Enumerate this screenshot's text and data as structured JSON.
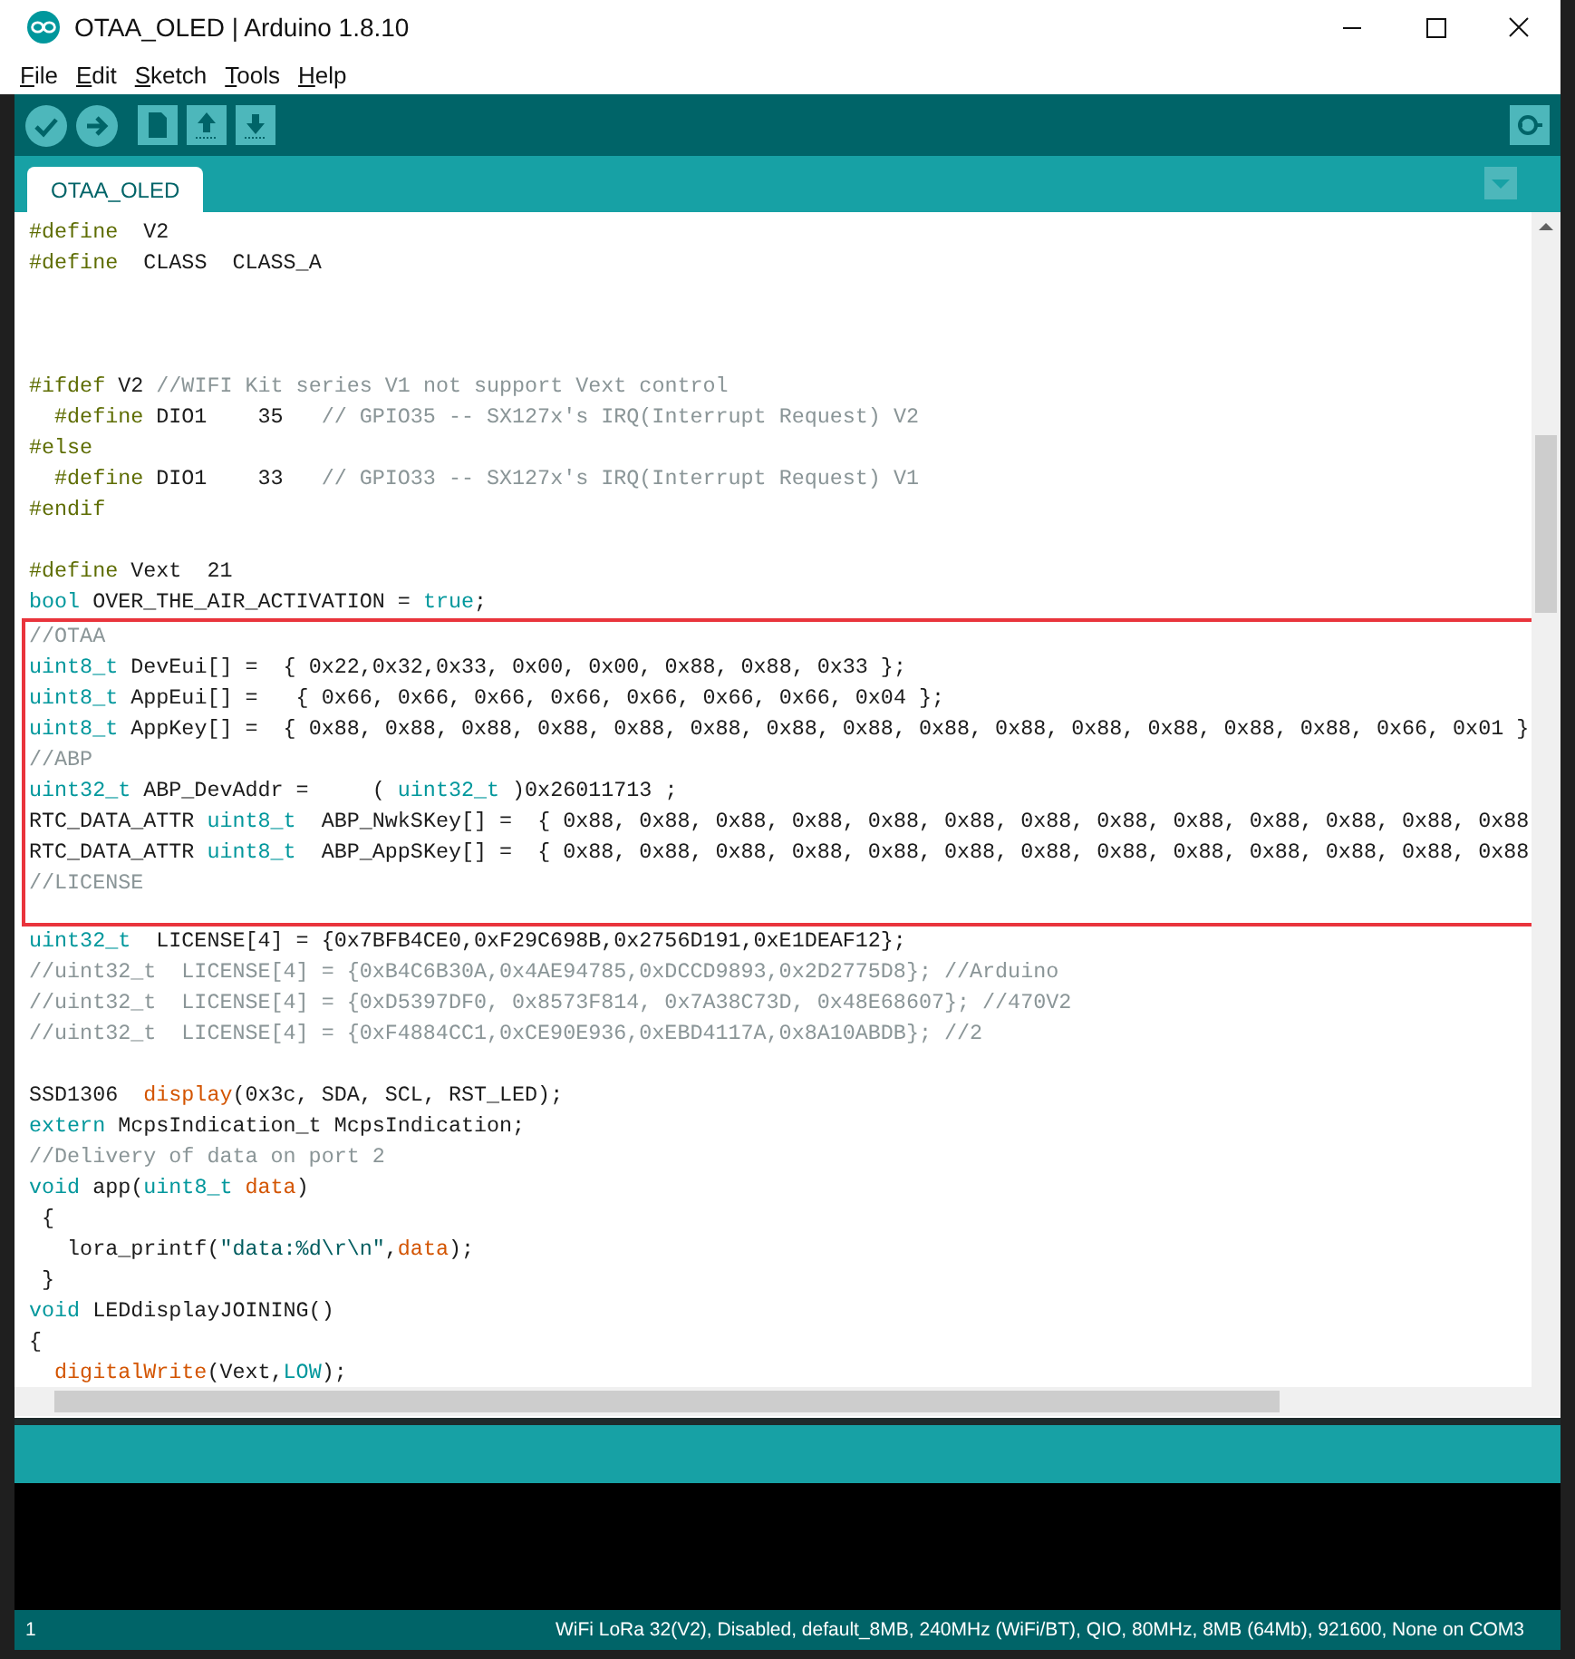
{
  "window": {
    "title": "OTAA_OLED | Arduino 1.8.10"
  },
  "menu": [
    "File",
    "Edit",
    "Sketch",
    "Tools",
    "Help"
  ],
  "tabs": [
    {
      "label": "OTAA_OLED",
      "selected": true
    }
  ],
  "code": [
    {
      "kind": "plain",
      "lines": [
        {
          "kind": "code",
          "tokens": [
            {
              "t": "#define",
              "kind": "directive"
            },
            {
              "t": "  V2",
              "kind": "plain"
            }
          ]
        },
        {
          "kind": "code",
          "tokens": [
            {
              "t": "#define",
              "kind": "directive"
            },
            {
              "t": "  CLASS  CLASS_A",
              "kind": "plain"
            }
          ]
        },
        {
          "kind": "blank"
        },
        {
          "kind": "blank"
        },
        {
          "kind": "blank"
        },
        {
          "kind": "code",
          "tokens": [
            {
              "t": "#ifdef",
              "kind": "directive"
            },
            {
              "t": " V2 ",
              "kind": "plain"
            },
            {
              "t": "//WIFI Kit series V1 not support Vext control",
              "kind": "comment"
            }
          ]
        },
        {
          "kind": "code",
          "tokens": [
            {
              "t": "  #define",
              "kind": "directive"
            },
            {
              "t": " DIO1    35   ",
              "kind": "plain"
            },
            {
              "t": "// GPIO35 -- SX127x's IRQ(Interrupt Request) V2",
              "kind": "comment"
            }
          ]
        },
        {
          "kind": "code",
          "tokens": [
            {
              "t": "#else",
              "kind": "directive"
            }
          ]
        },
        {
          "kind": "code",
          "tokens": [
            {
              "t": "  #define",
              "kind": "directive"
            },
            {
              "t": " DIO1    33   ",
              "kind": "plain"
            },
            {
              "t": "// GPIO33 -- SX127x's IRQ(Interrupt Request) V1",
              "kind": "comment"
            }
          ]
        },
        {
          "kind": "code",
          "tokens": [
            {
              "t": "#endif",
              "kind": "directive"
            }
          ]
        },
        {
          "kind": "blank"
        },
        {
          "kind": "code",
          "tokens": [
            {
              "t": "#define",
              "kind": "directive"
            },
            {
              "t": " Vext  21",
              "kind": "plain"
            }
          ]
        },
        {
          "kind": "code",
          "tokens": [
            {
              "t": "bool",
              "kind": "keyword"
            },
            {
              "t": " OVER_THE_AIR_ACTIVATION = ",
              "kind": "plain"
            },
            {
              "t": "true",
              "kind": "keyword"
            },
            {
              "t": ";",
              "kind": "plain"
            }
          ]
        }
      ]
    },
    {
      "kind": "boxed",
      "lines": [
        {
          "kind": "code",
          "tokens": [
            {
              "t": "//OTAA",
              "kind": "comment"
            }
          ]
        },
        {
          "kind": "code",
          "tokens": [
            {
              "t": "uint8_t",
              "kind": "keyword"
            },
            {
              "t": " DevEui[] =  { 0x22,0x32,0x33, 0x00, 0x00, 0x88, 0x88, 0x33 };",
              "kind": "plain"
            }
          ]
        },
        {
          "kind": "code",
          "tokens": [
            {
              "t": "uint8_t",
              "kind": "keyword"
            },
            {
              "t": " AppEui[] =   { 0x66, 0x66, 0x66, 0x66, 0x66, 0x66, 0x66, 0x04 };",
              "kind": "plain"
            }
          ]
        },
        {
          "kind": "code",
          "tokens": [
            {
              "t": "uint8_t",
              "kind": "keyword"
            },
            {
              "t": " AppKey[] =  { 0x88, 0x88, 0x88, 0x88, 0x88, 0x88, 0x88, 0x88, 0x88, 0x88, 0x88, 0x88, 0x88, 0x88, 0x66, 0x01 }",
              "kind": "plain"
            }
          ]
        },
        {
          "kind": "code",
          "tokens": [
            {
              "t": "//ABP",
              "kind": "comment"
            }
          ]
        },
        {
          "kind": "code",
          "tokens": [
            {
              "t": "uint32_t",
              "kind": "keyword"
            },
            {
              "t": " ABP_DevAddr =     ( ",
              "kind": "plain"
            },
            {
              "t": "uint32_t",
              "kind": "keyword"
            },
            {
              "t": " )0x26011713 ;",
              "kind": "plain"
            }
          ]
        },
        {
          "kind": "code",
          "tokens": [
            {
              "t": "RTC_DATA_ATTR ",
              "kind": "plain"
            },
            {
              "t": "uint8_t",
              "kind": "keyword"
            },
            {
              "t": "  ABP_NwkSKey[] =  { 0x88, 0x88, 0x88, 0x88, 0x88, 0x88, 0x88, 0x88, 0x88, 0x88, 0x88, 0x88, 0x88",
              "kind": "plain"
            }
          ]
        },
        {
          "kind": "code",
          "tokens": [
            {
              "t": "RTC_DATA_ATTR ",
              "kind": "plain"
            },
            {
              "t": "uint8_t",
              "kind": "keyword"
            },
            {
              "t": "  ABP_AppSKey[] =  { 0x88, 0x88, 0x88, 0x88, 0x88, 0x88, 0x88, 0x88, 0x88, 0x88, 0x88, 0x88, 0x88",
              "kind": "plain"
            }
          ]
        },
        {
          "kind": "code",
          "tokens": [
            {
              "t": "//LICENSE",
              "kind": "comment"
            }
          ]
        }
      ]
    },
    {
      "kind": "plain",
      "lines": [
        {
          "kind": "code",
          "tokens": [
            {
              "t": "uint32_t",
              "kind": "keyword"
            },
            {
              "t": "  LICENSE[4] = {0x7BFB4CE0,0xF29C698B,0x2756D191,0xE1DEAF12};",
              "kind": "plain"
            }
          ]
        },
        {
          "kind": "code",
          "tokens": [
            {
              "t": "//uint32_t  LICENSE[4] = {0xB4C6B30A,0x4AE94785,0xDCCD9893,0x2D2775D8}; //Arduino",
              "kind": "comment"
            }
          ]
        },
        {
          "kind": "code",
          "tokens": [
            {
              "t": "//uint32_t  LICENSE[4] = {0xD5397DF0, 0x8573F814, 0x7A38C73D, 0x48E68607}; //470V2",
              "kind": "comment"
            }
          ]
        },
        {
          "kind": "code",
          "tokens": [
            {
              "t": "//uint32_t  LICENSE[4] = {0xF4884CC1,0xCE90E936,0xEBD4117A,0x8A10ABDB}; //2",
              "kind": "comment"
            }
          ]
        },
        {
          "kind": "blank"
        },
        {
          "kind": "code",
          "tokens": [
            {
              "t": "SSD1306  ",
              "kind": "plain"
            },
            {
              "t": "display",
              "kind": "function"
            },
            {
              "t": "(0x3c, SDA, SCL, RST_LED);",
              "kind": "plain"
            }
          ]
        },
        {
          "kind": "code",
          "tokens": [
            {
              "t": "extern",
              "kind": "keyword"
            },
            {
              "t": " McpsIndication_t McpsIndication;",
              "kind": "plain"
            }
          ]
        },
        {
          "kind": "code",
          "tokens": [
            {
              "t": "//Delivery of data on port 2",
              "kind": "comment"
            }
          ]
        },
        {
          "kind": "code",
          "tokens": [
            {
              "t": "void",
              "kind": "keyword"
            },
            {
              "t": " app(",
              "kind": "plain"
            },
            {
              "t": "uint8_t ",
              "kind": "keyword"
            },
            {
              "t": "data",
              "kind": "function"
            },
            {
              "t": ")",
              "kind": "plain"
            }
          ]
        },
        {
          "kind": "code",
          "tokens": [
            {
              "t": " {",
              "kind": "plain"
            }
          ]
        },
        {
          "kind": "code",
          "tokens": [
            {
              "t": "   lora_printf(",
              "kind": "plain"
            },
            {
              "t": "\"data:%d\\r\\n\"",
              "kind": "string"
            },
            {
              "t": ",",
              "kind": "plain"
            },
            {
              "t": "data",
              "kind": "function"
            },
            {
              "t": ");",
              "kind": "plain"
            }
          ]
        },
        {
          "kind": "code",
          "tokens": [
            {
              "t": " }",
              "kind": "plain"
            }
          ]
        },
        {
          "kind": "code",
          "tokens": [
            {
              "t": "void",
              "kind": "keyword"
            },
            {
              "t": " LEDdisplayJOINING()",
              "kind": "plain"
            }
          ]
        },
        {
          "kind": "code",
          "tokens": [
            {
              "t": "{",
              "kind": "plain"
            }
          ]
        },
        {
          "kind": "code",
          "tokens": [
            {
              "t": "  digitalWrite",
              "kind": "function"
            },
            {
              "t": "(Vext,",
              "kind": "plain"
            },
            {
              "t": "LOW",
              "kind": "keyword"
            },
            {
              "t": ");",
              "kind": "plain"
            }
          ]
        }
      ]
    }
  ],
  "status_bar": {
    "line": "1",
    "board": "WiFi LoRa 32(V2), Disabled, default_8MB, 240MHz (WiFi/BT), QIO, 80MHz, 8MB (64Mb), 921600, None on COM3"
  }
}
